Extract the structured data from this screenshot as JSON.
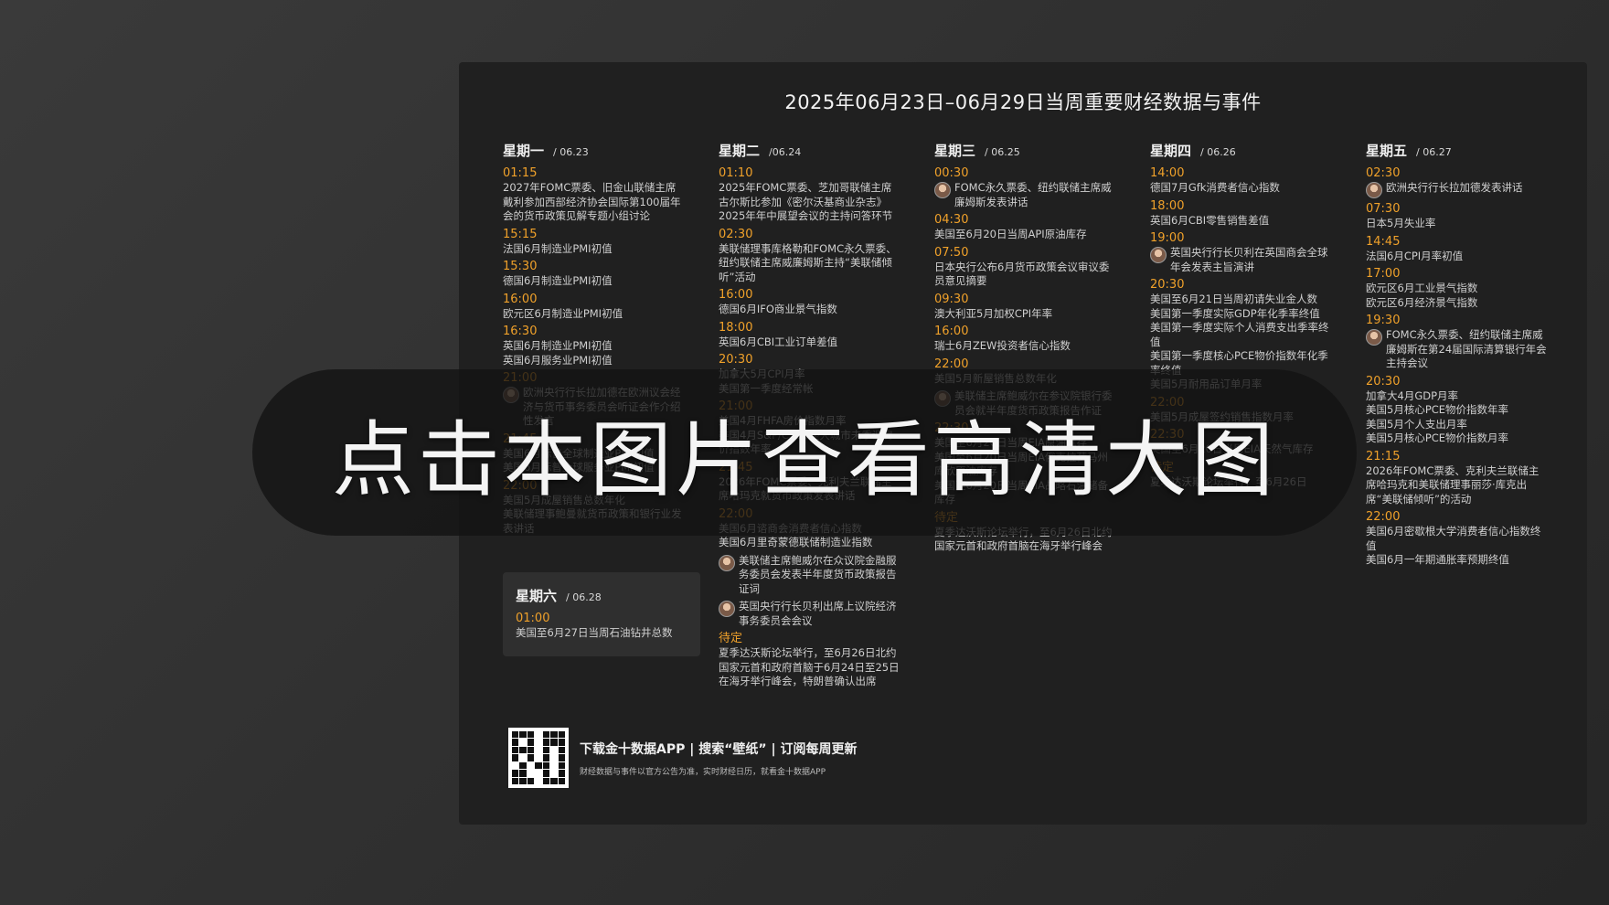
{
  "title": "2025年06月23日–06月29日当周重要财经数据与事件",
  "days": [
    {
      "name": "星期一",
      "date": "/ 06.23",
      "events": [
        {
          "time": "01:15",
          "lines": [
            "2027年FOMC票委、旧金山联储主席戴利参加西部经济协会国际第100届年会的货币政策见解专题小组讨论"
          ]
        },
        {
          "time": "15:15",
          "lines": [
            "法国6月制造业PMI初值"
          ]
        },
        {
          "time": "15:30",
          "lines": [
            "德国6月制造业PMI初值"
          ]
        },
        {
          "time": "16:00",
          "lines": [
            "欧元区6月制造业PMI初值"
          ]
        },
        {
          "time": "16:30",
          "lines": [
            "英国6月制造业PMI初值",
            "英国6月服务业PMI初值"
          ]
        },
        {
          "time": "21:00",
          "avatar": true,
          "lines": [
            "欧洲央行行长拉加德在欧洲议会经济与货币事务委员会听证会作介绍性发言"
          ]
        },
        {
          "time": "21:45",
          "lines": [
            "美国6月标普全球制造业PMI初值",
            "美国6月标普全球服务业PMI初值"
          ]
        },
        {
          "time": "22:00",
          "lines": [
            "美国5月成屋销售总数年化",
            "美联储理事鲍曼就货币政策和银行业发表讲话"
          ]
        }
      ]
    },
    {
      "name": "星期二",
      "date": "/06.24",
      "events": [
        {
          "time": "01:10",
          "lines": [
            "2025年FOMC票委、芝加哥联储主席古尔斯比参加《密尔沃基商业杂志》2025年年中展望会议的主持问答环节"
          ]
        },
        {
          "time": "02:30",
          "lines": [
            "美联储理事库格勒和FOMC永久票委、纽约联储主席威廉姆斯主持“美联储倾听”活动"
          ]
        },
        {
          "time": "16:00",
          "lines": [
            "德国6月IFO商业景气指数"
          ]
        },
        {
          "time": "18:00",
          "lines": [
            "英国6月CBI工业订单差值"
          ]
        },
        {
          "time": "20:30",
          "lines": [
            "加拿大5月CPI月率",
            "美国第一季度经常帐"
          ]
        },
        {
          "time": "21:00",
          "lines": [
            "美国4月FHFA房价指数月率",
            "美国4月S&P/CS20座大城市未季调房价指数年率"
          ]
        },
        {
          "time": "21:45",
          "lines": [
            "2026年FOMC票委、克利夫兰联储主席哈玛克就货币政策发表讲话"
          ]
        },
        {
          "time": "22:00",
          "lines": [
            "美国6月谘商会消费者信心指数",
            "美国6月里奇蒙德联储制造业指数"
          ]
        },
        {
          "time": "",
          "avatar": true,
          "lines": [
            "美联储主席鲍威尔在众议院金融服务委员会发表半年度货币政策报告证词"
          ]
        },
        {
          "time": "",
          "avatar": true,
          "lines": [
            "英国央行行长贝利出席上议院经济事务委员会会议"
          ]
        },
        {
          "time": "待定",
          "lines": [
            "夏季达沃斯论坛举行，至6月26日北约国家元首和政府首脑于6月24日至25日在海牙举行峰会，特朗普确认出席"
          ]
        }
      ]
    },
    {
      "name": "星期三",
      "date": "/ 06.25",
      "events": [
        {
          "time": "00:30",
          "avatar": true,
          "lines": [
            "FOMC永久票委、纽约联储主席威廉姆斯发表讲话"
          ]
        },
        {
          "time": "04:30",
          "lines": [
            "美国至6月20日当周API原油库存"
          ]
        },
        {
          "time": "07:50",
          "lines": [
            "日本央行公布6月货币政策会议审议委员意见摘要"
          ]
        },
        {
          "time": "09:30",
          "lines": [
            "澳大利亚5月加权CPI年率"
          ]
        },
        {
          "time": "16:00",
          "lines": [
            "瑞士6月ZEW投资者信心指数"
          ]
        },
        {
          "time": "22:00",
          "lines": [
            "美国5月新屋销售总数年化"
          ]
        },
        {
          "time": "",
          "avatar": true,
          "lines": [
            "美联储主席鲍威尔在参议院银行委员会就半年度货币政策报告作证"
          ]
        },
        {
          "time": "22:30",
          "lines": [
            "美国至6月20日当周EIA原油库存",
            "美国至6月20日当周EIA俄克拉荷马州库欣原油库存",
            "美国至6月20日当周EIA战略石油储备库存"
          ]
        },
        {
          "time": "待定",
          "lines": [
            "夏季达沃斯论坛举行，至6月26日北约国家元首和政府首脑在海牙举行峰会"
          ]
        }
      ]
    },
    {
      "name": "星期四",
      "date": "/ 06.26",
      "events": [
        {
          "time": "14:00",
          "lines": [
            "德国7月Gfk消费者信心指数"
          ]
        },
        {
          "time": "18:00",
          "lines": [
            "英国6月CBI零售销售差值"
          ]
        },
        {
          "time": "19:00",
          "avatar": true,
          "lines": [
            "英国央行行长贝利在英国商会全球年会发表主旨演讲"
          ]
        },
        {
          "time": "20:30",
          "lines": [
            "美国至6月21日当周初请失业金人数",
            "美国第一季度实际GDP年化季率终值",
            "美国第一季度实际个人消费支出季率终值",
            "美国第一季度核心PCE物价指数年化季率终值",
            "美国5月耐用品订单月率"
          ]
        },
        {
          "time": "22:00",
          "lines": [
            "美国5月成屋签约销售指数月率"
          ]
        },
        {
          "time": "22:30",
          "lines": [
            "美国至6月20日当周EIA天然气库存"
          ]
        },
        {
          "time": "待定",
          "lines": [
            "夏季达沃斯论坛举行，至6月26日"
          ]
        }
      ]
    },
    {
      "name": "星期五",
      "date": "/ 06.27",
      "events": [
        {
          "time": "02:30",
          "avatar": true,
          "lines": [
            "欧洲央行行长拉加德发表讲话"
          ]
        },
        {
          "time": "07:30",
          "lines": [
            "日本5月失业率"
          ]
        },
        {
          "time": "14:45",
          "lines": [
            "法国6月CPI月率初值"
          ]
        },
        {
          "time": "17:00",
          "lines": [
            "欧元区6月工业景气指数",
            "欧元区6月经济景气指数"
          ]
        },
        {
          "time": "19:30",
          "avatar": true,
          "lines": [
            "FOMC永久票委、纽约联储主席威廉姆斯在第24届国际清算银行年会主持会议"
          ]
        },
        {
          "time": "20:30",
          "lines": [
            "加拿大4月GDP月率",
            "美国5月核心PCE物价指数年率",
            "美国5月个人支出月率",
            "美国5月核心PCE物价指数月率"
          ]
        },
        {
          "time": "21:15",
          "lines": [
            "2026年FOMC票委、克利夫兰联储主席哈玛克和美联储理事丽莎·库克出席“美联储倾听”的活动"
          ]
        },
        {
          "time": "22:00",
          "lines": [
            "美国6月密歇根大学消费者信心指数终值",
            "美国6月一年期通胀率预期终值"
          ]
        }
      ]
    }
  ],
  "saturday": {
    "name": "星期六",
    "date": "/ 06.28",
    "events": [
      {
        "time": "01:00",
        "lines": [
          "美国至6月27日当周石油钻井总数"
        ]
      }
    ]
  },
  "footer": {
    "main": "下载金十数据APP | 搜索“壁纸” | 订阅每周更新",
    "sub": "财经数据与事件以官方公告为准，实时财经日历，就看金十数据APP",
    "qr_icon": "qr-code-icon"
  },
  "overlay": {
    "text": "点击本图片查看高清大图"
  },
  "colors": {
    "time": "#f0a12a",
    "card": "#202020",
    "overlay": "#121212"
  }
}
